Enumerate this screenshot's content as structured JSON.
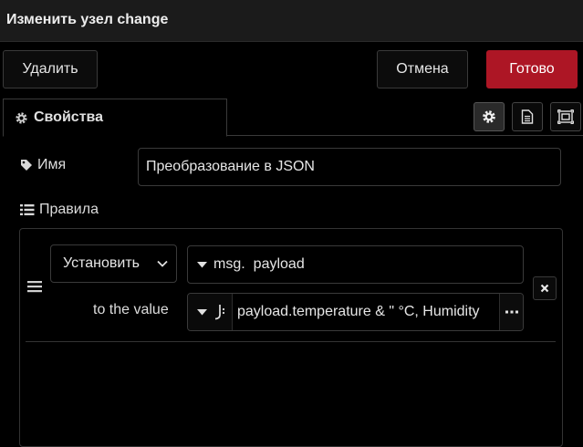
{
  "dialog": {
    "title": "Изменить узел change",
    "delete_label": "Удалить",
    "cancel_label": "Отмена",
    "done_label": "Готово",
    "done_color": "#ad1625"
  },
  "tabs": {
    "properties_label": "Свойства",
    "icons": [
      "gear-icon",
      "description-icon",
      "appearance-icon"
    ]
  },
  "form": {
    "name_label": "Имя",
    "name_value": "Преобразование в JSON",
    "rules_label": "Правила"
  },
  "rule": {
    "action": "Установить",
    "target_type": "msg.",
    "target_value": "payload",
    "to_value_label": "to the value",
    "value_type_icon": "jsonata-icon",
    "value": "payload.temperature & \" °C, Humidity"
  }
}
